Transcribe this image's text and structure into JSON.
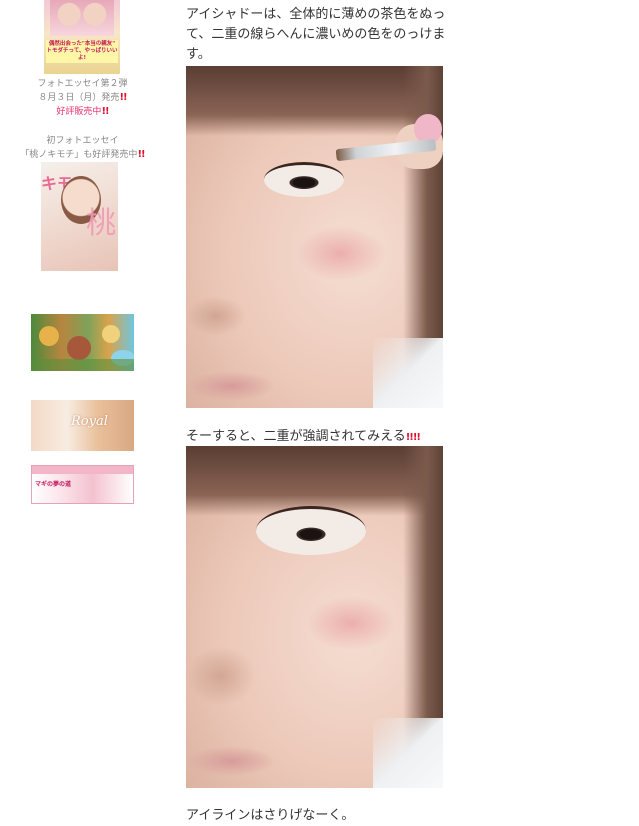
{
  "sidebar": {
    "book1": {
      "cover_text": "偶然出会った\"本当の親友\"\nトモダチって、やっぱりいいよ!",
      "caption_line1": "フォトエッセイ第２弾",
      "caption_line2": "８月３日（月）発売",
      "caption_line3": "好評販売中"
    },
    "book2": {
      "caption_line1": "初フォトエッセイ",
      "caption_line2": "「桃ノキモチ」も好評発売中",
      "cover_kanji": "桃",
      "cover_top": "キモ"
    },
    "banners": {
      "banner2_text": "Royal",
      "banner3_text": "マギの夢の道"
    }
  },
  "main": {
    "paragraph1": "アイシャドーは、全体的に薄めの茶色をぬって、二重の線らへんに濃いめの色をのっけます。",
    "paragraph2": "そーすると、二重が強調されてみえる",
    "paragraph2_emoji": "!!!!",
    "paragraph3": "アイラインはさりげなーく。"
  },
  "colors": {
    "accent_pink": "#e8326b",
    "exclaim_red": "#e0122f",
    "caption_gray": "#888888"
  }
}
